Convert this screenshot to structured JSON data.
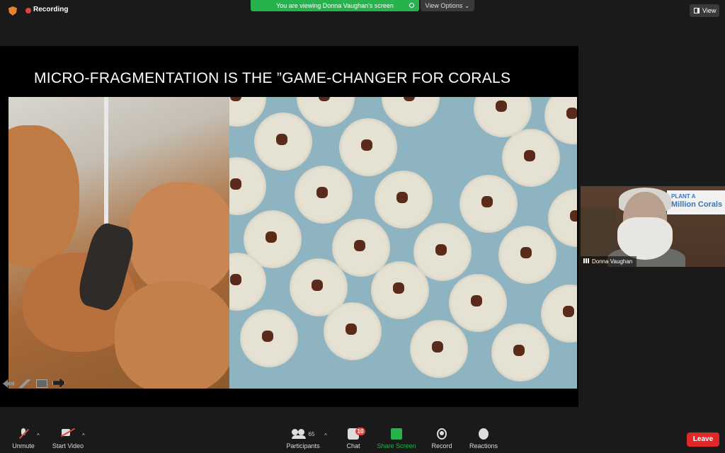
{
  "topbar": {
    "recording_label": "Recording",
    "viewing_banner": "You are viewing Donna Vaughan's screen",
    "view_options_label": "View Options ⌄",
    "view_button_label": "View"
  },
  "slide": {
    "title": "MICRO-FRAGMENTATION IS THE  ”GAME-CHANGER FOR CORALS"
  },
  "video": {
    "participant_name": "Donna Vaughan",
    "sign_line1": "PLANT A",
    "sign_line2": "Million Corals"
  },
  "footer": {
    "unmute_label": "Unmute",
    "start_video_label": "Start Video",
    "participants_label": "Participants",
    "participants_count": "65",
    "chat_label": "Chat",
    "chat_badge": "10",
    "share_screen_label": "Share Screen",
    "record_label": "Record",
    "reactions_label": "Reactions",
    "leave_label": "Leave"
  },
  "colors": {
    "share_green": "#26b24d",
    "leave_red": "#e02828",
    "recording_red": "#e0443e"
  }
}
